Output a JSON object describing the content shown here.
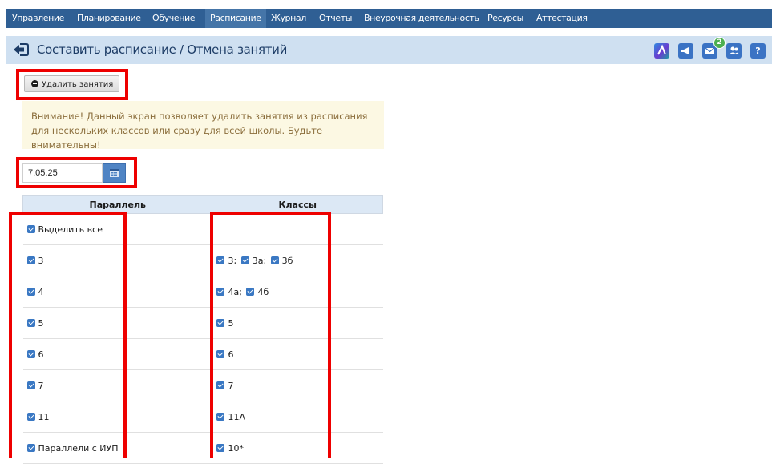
{
  "nav": {
    "items": [
      {
        "label": "Управление",
        "active": false
      },
      {
        "label": "Планирование",
        "active": false
      },
      {
        "label": "Обучение",
        "active": false
      },
      {
        "label": "Расписание",
        "active": true
      },
      {
        "label": "Журнал",
        "active": false
      },
      {
        "label": "Отчеты",
        "active": false
      },
      {
        "label": "Внеурочная деятельность",
        "active": false
      },
      {
        "label": "Ресурсы",
        "active": false
      },
      {
        "label": "Аттестация",
        "active": false
      }
    ]
  },
  "header": {
    "title": "Составить расписание / Отмена занятий",
    "mail_badge_count": "2",
    "help_label": "?",
    "icons": [
      "app-logo-icon",
      "announcement-icon",
      "mail-icon",
      "users-icon",
      "help-icon"
    ]
  },
  "actions": {
    "delete_lessons_label": "Удалить занятия"
  },
  "warning": {
    "text": "Внимание! Данный экран позволяет удалить занятия из расписания для нескольких классов или сразу для всей школы. Будьте внимательны!"
  },
  "date": {
    "value": "7.05.25"
  },
  "table": {
    "headers": {
      "parallel": "Параллель",
      "classes": "Классы"
    },
    "rows": [
      {
        "parallel": "Выделить все",
        "checked": true,
        "classes": []
      },
      {
        "parallel": "3",
        "checked": true,
        "classes": [
          "3",
          "3а",
          "3б"
        ]
      },
      {
        "parallel": "4",
        "checked": true,
        "classes": [
          "4а",
          "4б"
        ]
      },
      {
        "parallel": "5",
        "checked": true,
        "classes": [
          "5"
        ]
      },
      {
        "parallel": "6",
        "checked": true,
        "classes": [
          "6"
        ]
      },
      {
        "parallel": "7",
        "checked": true,
        "classes": [
          "7"
        ]
      },
      {
        "parallel": "11",
        "checked": true,
        "classes": [
          "11А"
        ]
      },
      {
        "parallel": "Параллели с ИУП",
        "checked": true,
        "classes": [
          "10*"
        ]
      }
    ]
  },
  "colors": {
    "nav_bg": "#2f5f94",
    "nav_active_bg": "#4575a8",
    "title_bar_bg": "#cfe0f1",
    "warning_bg": "#fcf8e3",
    "warning_text": "#8a6d3b",
    "table_header_bg": "#dce8f5",
    "checkbox": "#3a78c3",
    "highlight_box": "#ee0000"
  }
}
